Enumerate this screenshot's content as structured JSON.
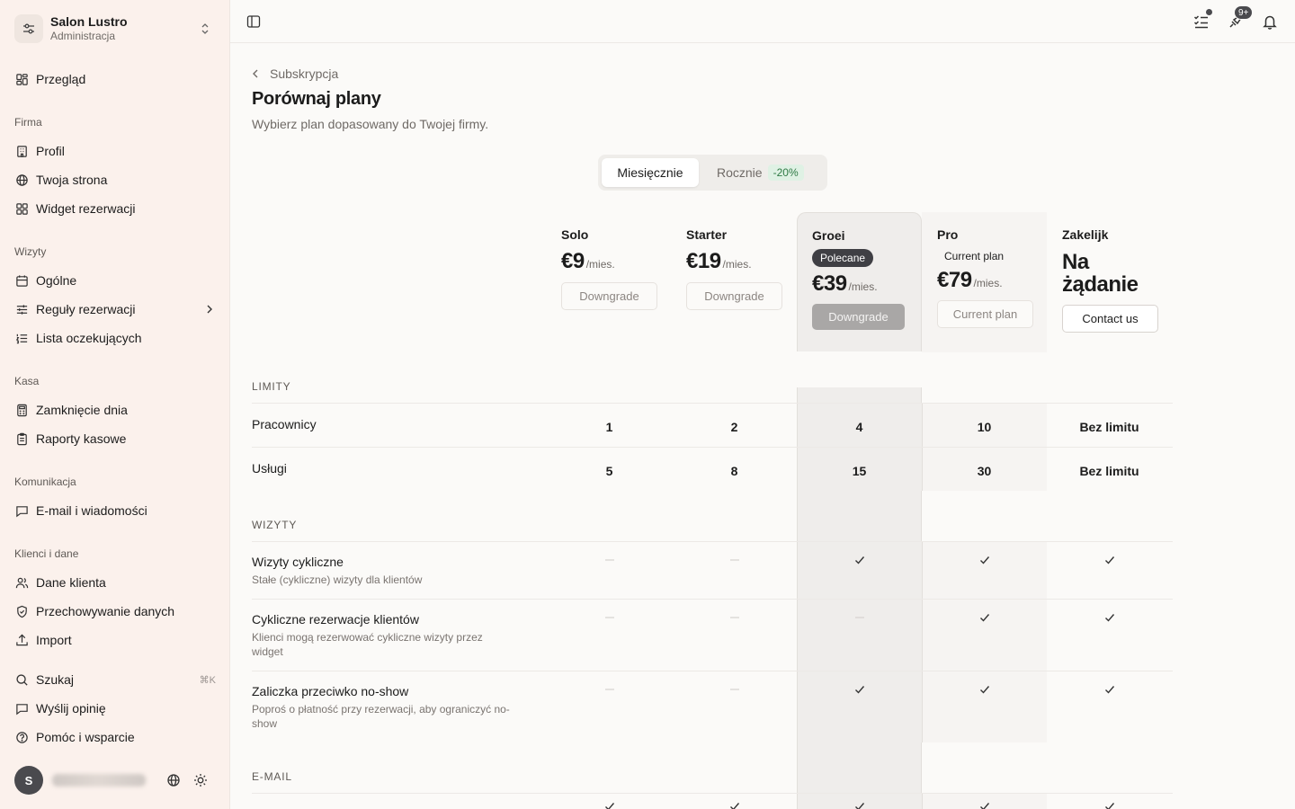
{
  "sidebar": {
    "org_name": "Salon Lustro",
    "org_sub": "Administracja",
    "overview": "Przegląd",
    "sections": {
      "firma": "Firma",
      "wizyty": "Wizyty",
      "kasa": "Kasa",
      "komunikacja": "Komunikacja",
      "klienci": "Klienci i dane"
    },
    "items": {
      "profil": "Profil",
      "strona": "Twoja strona",
      "widget": "Widget rezerwacji",
      "ogolne": "Ogólne",
      "reguly": "Reguły rezerwacji",
      "lista": "Lista oczekujących",
      "zamkniecie": "Zamknięcie dnia",
      "raporty": "Raporty kasowe",
      "email": "E-mail i wiadomości",
      "dane": "Dane klienta",
      "przechowywanie": "Przechowywanie danych",
      "import": "Import",
      "szukaj": "Szukaj",
      "szukaj_kbd": "⌘K",
      "opinia": "Wyślij opinię",
      "pomoc": "Pomóc i wsparcie"
    },
    "avatar_initial": "S"
  },
  "topbar": {
    "notif_badge": "9+"
  },
  "page": {
    "breadcrumb": "Subskrypcja",
    "title": "Porównaj plany",
    "subtitle": "Wybierz plan dopasowany do Twojej firmy."
  },
  "billing": {
    "monthly": "Miesięcznie",
    "yearly": "Rocznie",
    "yearly_discount": "-20%",
    "selected": "Miesięcznie"
  },
  "plans": [
    {
      "name": "Solo",
      "price": "€9",
      "per": "/mies.",
      "button": "Downgrade"
    },
    {
      "name": "Starter",
      "price": "€19",
      "per": "/mies.",
      "button": "Downgrade"
    },
    {
      "name": "Groei",
      "badge": "Polecane",
      "price": "€39",
      "per": "/mies.",
      "button": "Downgrade"
    },
    {
      "name": "Pro",
      "badge": "Current plan",
      "price": "€79",
      "per": "/mies.",
      "button": "Current plan"
    },
    {
      "name": "Zakelijk",
      "price_line1": "Na",
      "price_line2": "żądanie",
      "button": "Contact us"
    }
  ],
  "sections": {
    "limity": "LIMITY",
    "wizyty": "WIZYTY",
    "email": "E-MAIL"
  },
  "limits": [
    {
      "label": "Pracownicy",
      "values": [
        "1",
        "2",
        "4",
        "10",
        "Bez limitu"
      ]
    },
    {
      "label": "Usługi",
      "values": [
        "5",
        "8",
        "15",
        "30",
        "Bez limitu"
      ]
    }
  ],
  "features": [
    {
      "label": "Wizyty cykliczne",
      "desc": "Stałe (cykliczne) wizyty dla klientów",
      "values": [
        false,
        false,
        true,
        true,
        true
      ]
    },
    {
      "label": "Cykliczne rezerwacje klientów",
      "desc": "Klienci mogą rezerwować cykliczne wizyty przez widget",
      "values": [
        false,
        false,
        false,
        true,
        true
      ]
    },
    {
      "label": "Zaliczka przeciwko no-show",
      "desc": "Poproś o płatność przy rezerwacji, aby ograniczyć no-show",
      "values": [
        false,
        false,
        true,
        true,
        true
      ]
    }
  ],
  "email_row": {
    "values": [
      true,
      true,
      true,
      true,
      true
    ]
  }
}
